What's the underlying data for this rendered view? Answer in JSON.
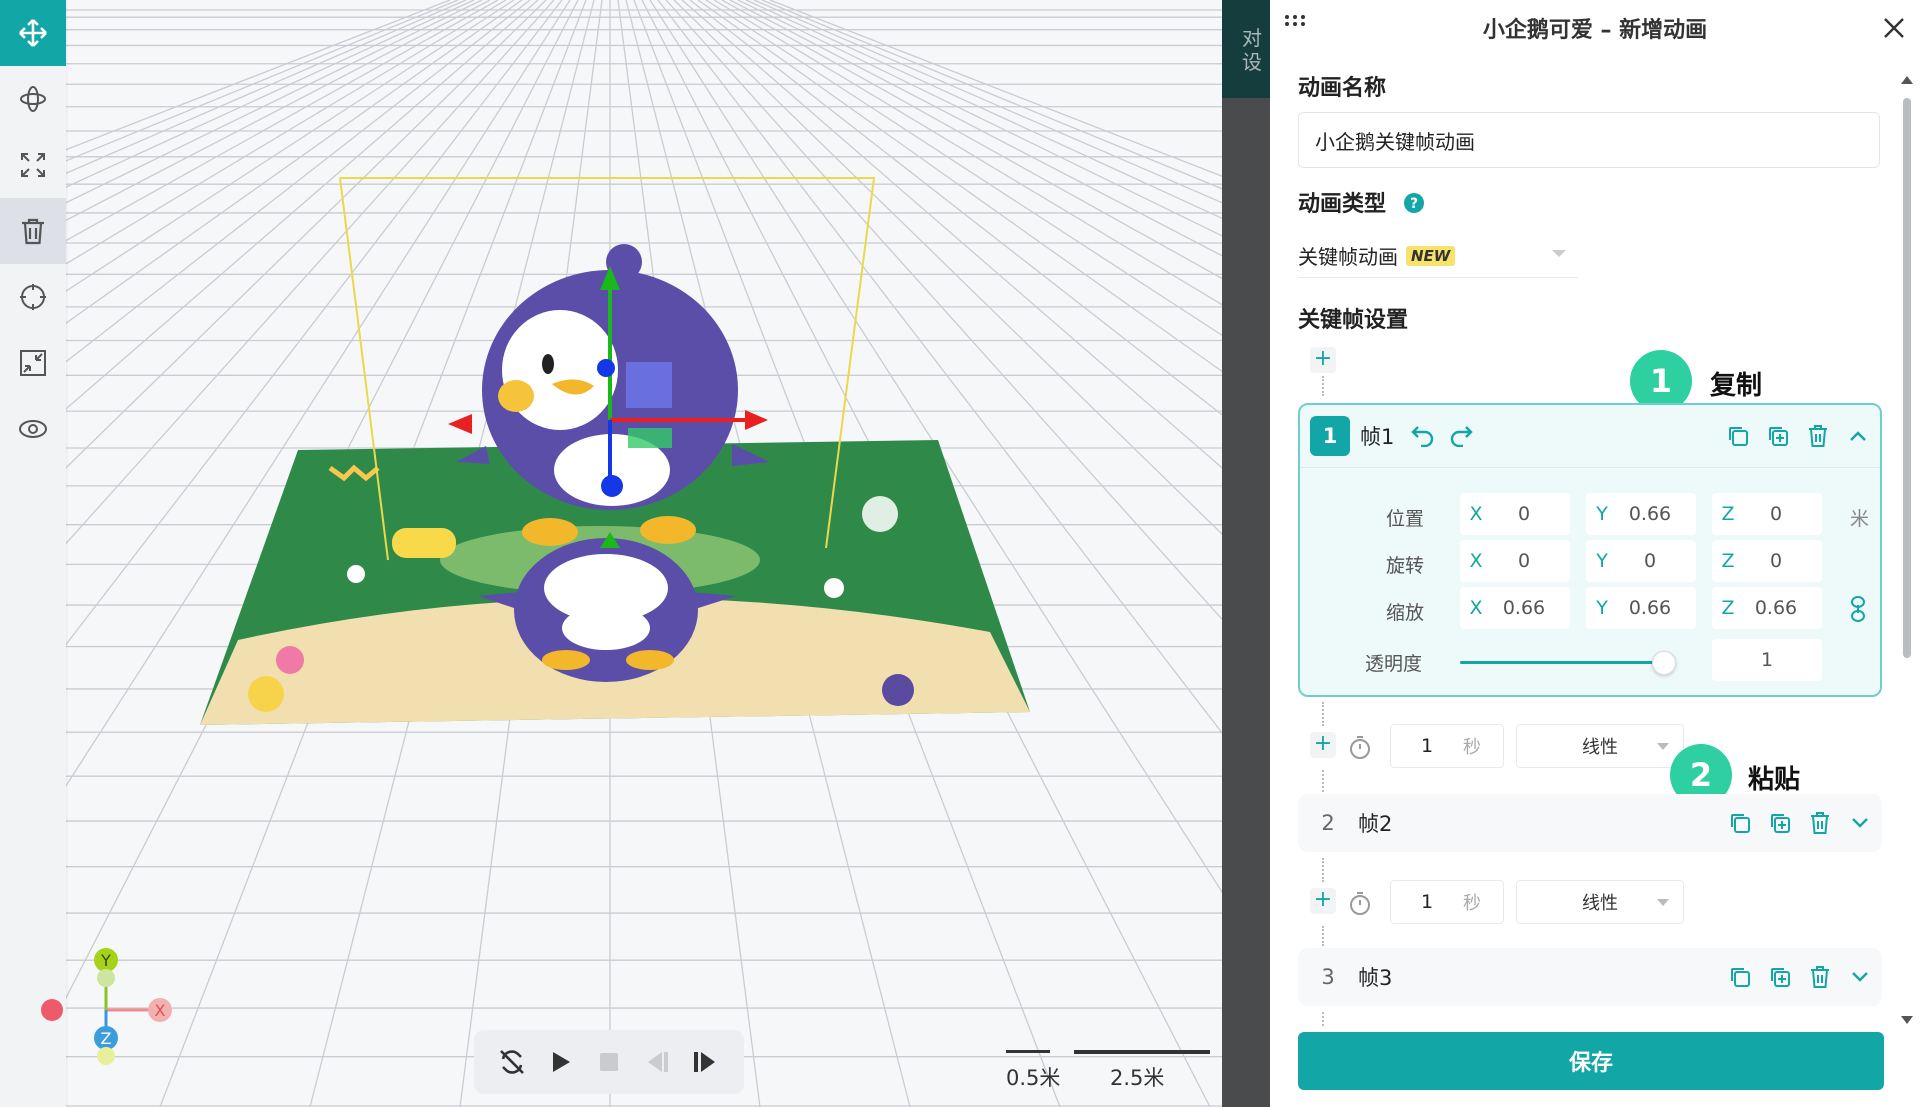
{
  "panel": {
    "title": "小企鹅可爱 – 新增动画",
    "name_label": "动画名称",
    "name_value": "小企鹅关键帧动画",
    "type_label": "动画类型",
    "type_value": "关键帧动画",
    "type_badge": "NEW",
    "keyframe_label": "关键帧设置",
    "save": "保存"
  },
  "left_tab": {
    "line1": "对",
    "line2": "设"
  },
  "frames": [
    {
      "num": "1",
      "name": "帧1"
    },
    {
      "num": "2",
      "name": "帧2"
    },
    {
      "num": "3",
      "name": "帧3"
    }
  ],
  "frame1": {
    "position": {
      "label": "位置",
      "x": "0",
      "y": "0.66",
      "z": "0",
      "unit": "米"
    },
    "rotation": {
      "label": "旋转",
      "x": "0",
      "y": "0",
      "z": "0"
    },
    "scale": {
      "label": "缩放",
      "x": "0.66",
      "y": "0.66",
      "z": "0.66"
    },
    "opacity": {
      "label": "透明度",
      "value": "1",
      "level": 1.0
    }
  },
  "axes": {
    "x": "X",
    "y": "Y",
    "z": "Z"
  },
  "transitions": [
    {
      "duration": "1",
      "unit": "秒",
      "easing": "线性"
    },
    {
      "duration": "1",
      "unit": "秒",
      "easing": "线性"
    }
  ],
  "callouts": [
    {
      "num": "1",
      "text": "复制"
    },
    {
      "num": "2",
      "text": "粘贴"
    }
  ],
  "gizmo": {
    "x": "X",
    "y": "Y",
    "z": "Z"
  },
  "scale_bar": {
    "small": "0.5米",
    "large": "2.5米"
  },
  "colors": {
    "accent": "#13a6a6",
    "callout": "#2ecfa0",
    "badge": "#f8e36a"
  }
}
